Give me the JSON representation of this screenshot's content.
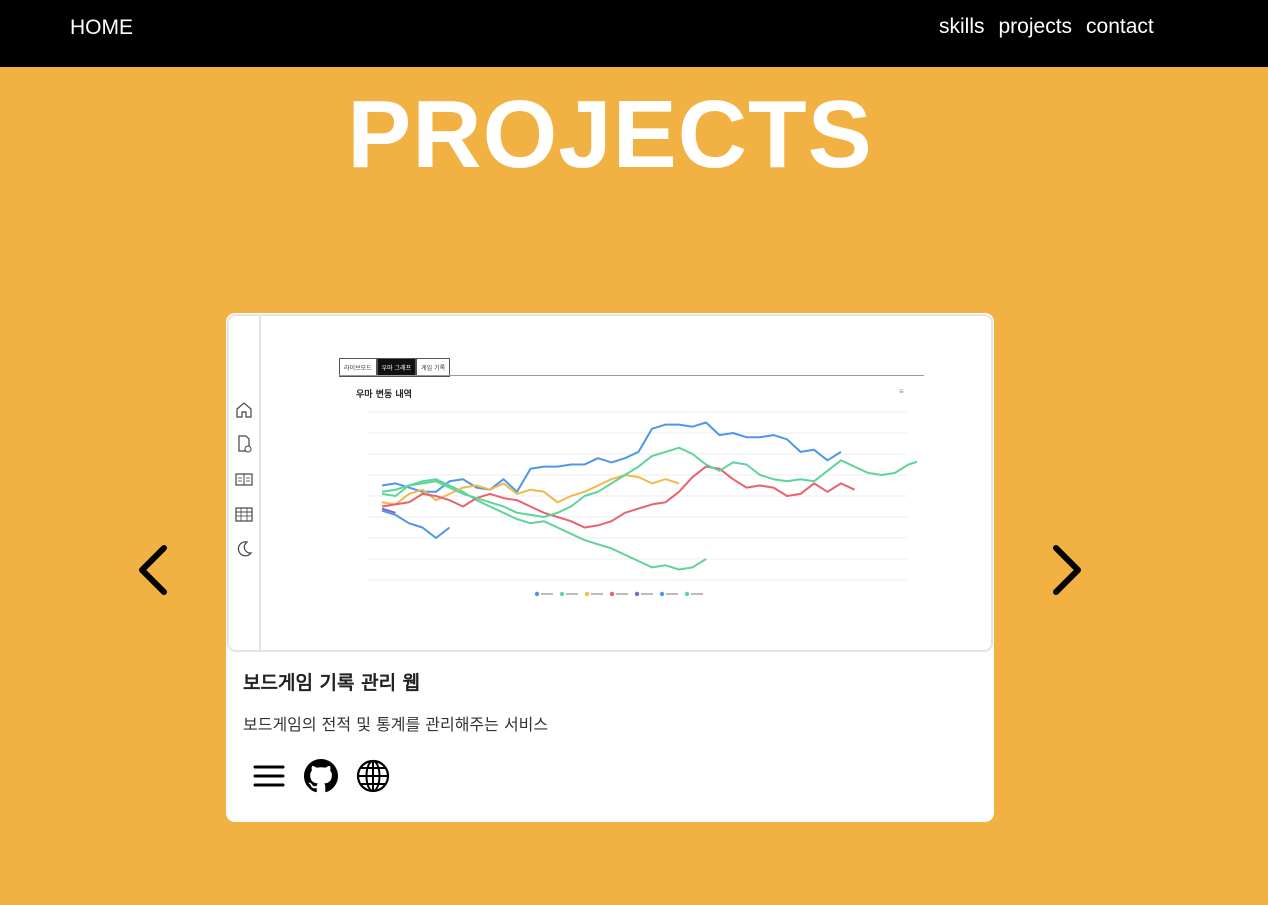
{
  "nav": {
    "home": "HOME",
    "links": [
      "skills",
      "projects",
      "contact"
    ]
  },
  "page": {
    "title": "PROJECTS"
  },
  "project": {
    "title": "보드게임 기록 관리 웹",
    "description": "보드게임의 전적 및 통계를 관리해주는 서비스",
    "screenshot": {
      "tabs": [
        "라이브모드",
        "우마 그래프",
        "게임 기록"
      ],
      "active_tab": 1,
      "chart_title": "우마 변동 내역",
      "sidebar_icons": [
        "home-icon",
        "document-icon",
        "book-icon",
        "table-icon",
        "moon-icon"
      ]
    }
  },
  "colors": {
    "background": "#f2b143",
    "navbar": "#000000",
    "series": [
      "#4e97e8",
      "#5fd49a",
      "#f2b94a",
      "#e8636f",
      "#7a66c9",
      "#4e97e8",
      "#5fd49a"
    ]
  },
  "icons": {
    "prev": "chevron-left-icon",
    "next": "chevron-right-icon",
    "actions": [
      "menu-icon",
      "github-icon",
      "globe-icon"
    ]
  },
  "chart_data": {
    "type": "line",
    "series": [
      {
        "values": [
          0.5,
          0.6,
          0.4,
          0.2,
          0.2,
          0.7,
          0.8,
          0.4,
          0.3,
          0.8,
          0.2,
          1.3,
          1.4,
          1.4,
          1.5,
          1.5,
          1.8,
          1.6,
          1.8,
          2.1,
          3.2,
          3.4,
          3.4,
          3.3,
          3.5,
          2.9,
          3.0,
          2.8,
          2.8,
          2.9,
          2.7,
          2.1,
          2.2,
          1.7,
          2.1
        ]
      },
      {
        "values": [
          0.1,
          0.0,
          0.5,
          0.7,
          0.8,
          0.5,
          0.2,
          -0.2,
          -0.5,
          -0.8,
          -1.1,
          -1.3,
          -1.2,
          -1.5,
          -1.8,
          -2.1,
          -2.3,
          -2.5,
          -2.8,
          -3.1,
          -3.4,
          -3.3,
          -3.5,
          -3.4,
          -3.0
        ]
      },
      {
        "values": [
          -0.3,
          -0.4,
          0.1,
          0.3,
          -0.2,
          0.1,
          0.4,
          0.5,
          0.3,
          0.6,
          0.1,
          0.3,
          0.2,
          -0.3,
          0.0,
          0.2,
          0.5,
          0.8,
          1.0,
          0.9,
          0.6,
          0.8,
          0.6
        ]
      },
      {
        "values": [
          -0.5,
          -0.4,
          -0.3,
          0.1,
          0.0,
          -0.2,
          -0.5,
          -0.1,
          0.1,
          -0.1,
          -0.2,
          -0.5,
          -0.8,
          -1.0,
          -1.2,
          -1.5,
          -1.4,
          -1.2,
          -0.8,
          -0.6,
          -0.4,
          -0.3,
          0.2,
          0.9,
          1.4,
          1.3,
          0.8,
          0.4,
          0.5,
          0.4,
          0.0,
          0.1,
          0.6,
          0.2,
          0.6,
          0.3
        ]
      },
      {
        "values": [
          -0.6,
          -0.8
        ]
      },
      {
        "values": [
          -0.7,
          -0.9,
          -1.3,
          -1.5,
          -2.0,
          -1.5
        ]
      },
      {
        "values": [
          0.2,
          0.3,
          0.5,
          0.6,
          0.7,
          0.4,
          0.1,
          -0.1,
          -0.3,
          -0.5,
          -0.8,
          -0.9,
          -1.0,
          -0.8,
          -0.5,
          0.0,
          0.2,
          0.6,
          1.0,
          1.4,
          1.9,
          2.1,
          2.3,
          2.0,
          1.5,
          1.2,
          1.6,
          1.5,
          1.0,
          0.8,
          0.7,
          0.8,
          0.7,
          1.2,
          1.7,
          1.4,
          1.1,
          1.0,
          1.1,
          1.5,
          1.7
        ]
      }
    ],
    "ylim": [
      -4,
      4
    ]
  }
}
